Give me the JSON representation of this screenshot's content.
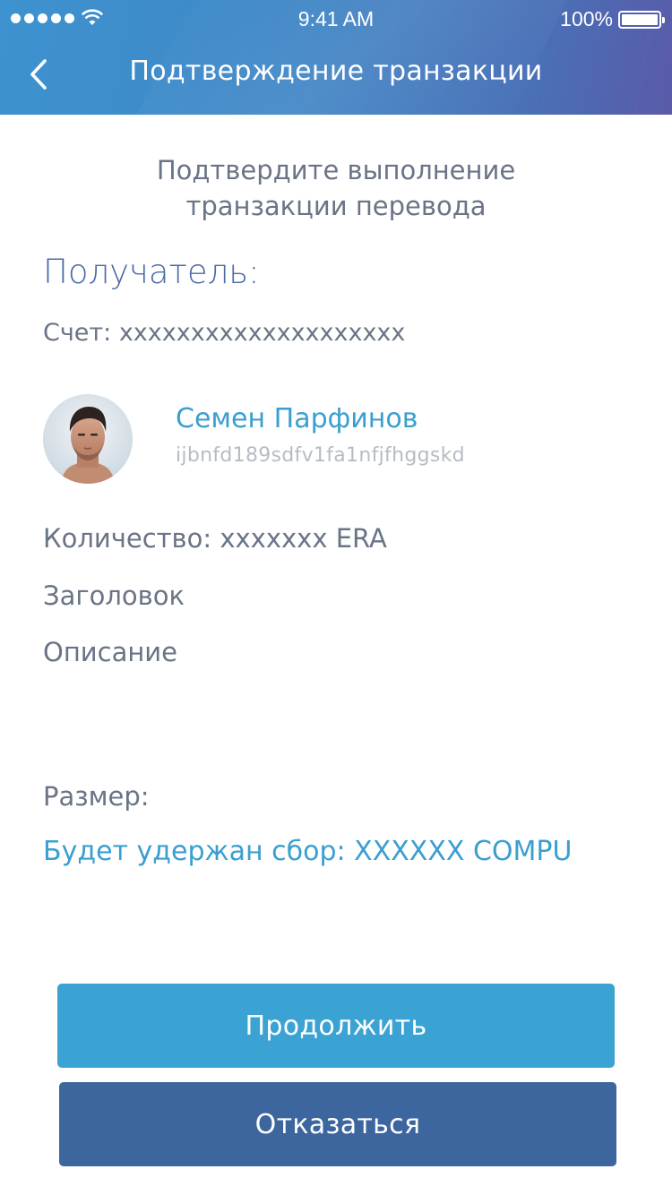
{
  "status_bar": {
    "time": "9:41 AM",
    "battery_percent": "100%",
    "signal_bars": 5,
    "icons": [
      "signal-dots-icon",
      "wifi-icon",
      "battery-icon"
    ]
  },
  "nav": {
    "title": "Подтверждение транзакции",
    "back_icon": "chevron-left-icon"
  },
  "prompt": "Подтвердите выполнение транзакции перевода",
  "recipient": {
    "title": "Получатель:",
    "account_label": "Счет: xxxxxxxxxxxxxxxxxxxx",
    "name": "Семен Парфинов",
    "address": "ijbnfd189sdfv1fa1nfjfhggskd"
  },
  "fields": {
    "amount": "Количество: xxxxxxx ERA",
    "header": "Заголовок",
    "description": "Описание",
    "size": "Размер:"
  },
  "fee": "Будет удержан сбор: XXXXXX COMPU",
  "buttons": {
    "continue": "Продолжить",
    "decline": "Отказаться"
  },
  "colors": {
    "accent_blue": "#3ba3d4",
    "dark_blue": "#3d669f",
    "header_gradient_start": "#3d93cf",
    "header_gradient_end": "#5a5aa8",
    "link_text": "#3a9fd0"
  }
}
